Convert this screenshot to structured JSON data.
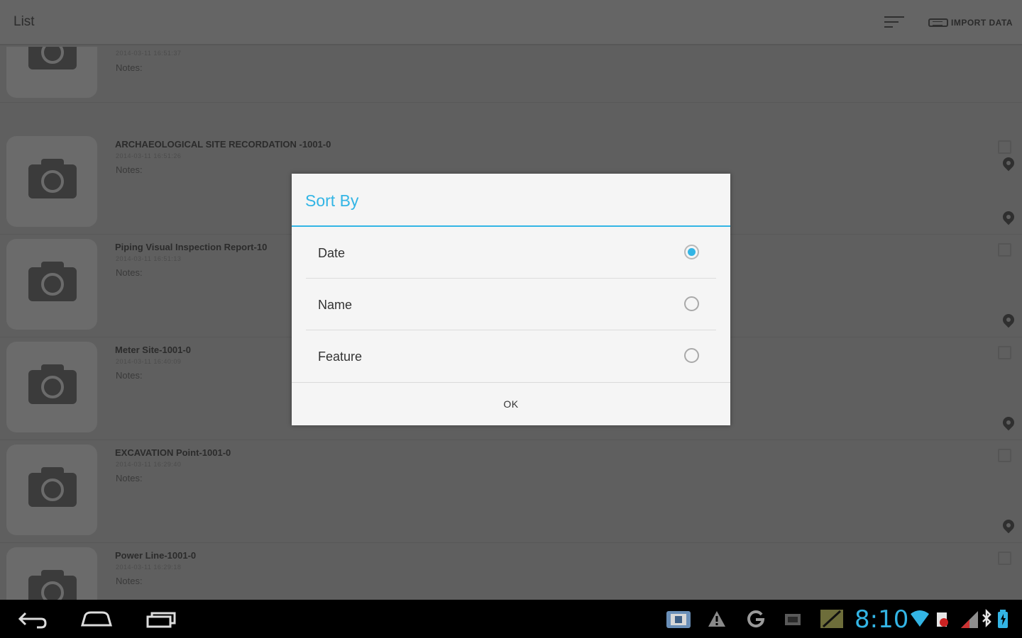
{
  "actionbar": {
    "title": "List",
    "sort_icon": "sort-icon",
    "import_label": "IMPORT DATA",
    "import_icon": "import-data-icon"
  },
  "list": {
    "items": [
      {
        "title": "",
        "date": "2014-03-11 16:51:37",
        "notes": "Notes:"
      },
      {
        "title": "ARCHAEOLOGICAL SITE RECORDATION -1001-0",
        "date": "2014-03-11 16:51:26",
        "notes": "Notes:"
      },
      {
        "title": "Piping Visual Inspection Report-10",
        "date": "2014-03-11 16:51:13",
        "notes": "Notes:"
      },
      {
        "title": "Meter Site-1001-0",
        "date": "2014-03-11 16:40:09",
        "notes": "Notes:"
      },
      {
        "title": "EXCAVATION Point-1001-0",
        "date": "2014-03-11 16:29:40",
        "notes": "Notes:"
      },
      {
        "title": "Power Line-1001-0",
        "date": "2014-03-11 16:29:18",
        "notes": "Notes:"
      }
    ]
  },
  "dialog": {
    "title": "Sort By",
    "options": [
      {
        "label": "Date",
        "selected": true
      },
      {
        "label": "Name",
        "selected": false
      },
      {
        "label": "Feature",
        "selected": false
      }
    ],
    "ok_label": "OK"
  },
  "navbar": {
    "clock": "8:10",
    "accent_color": "#33b5e5"
  }
}
